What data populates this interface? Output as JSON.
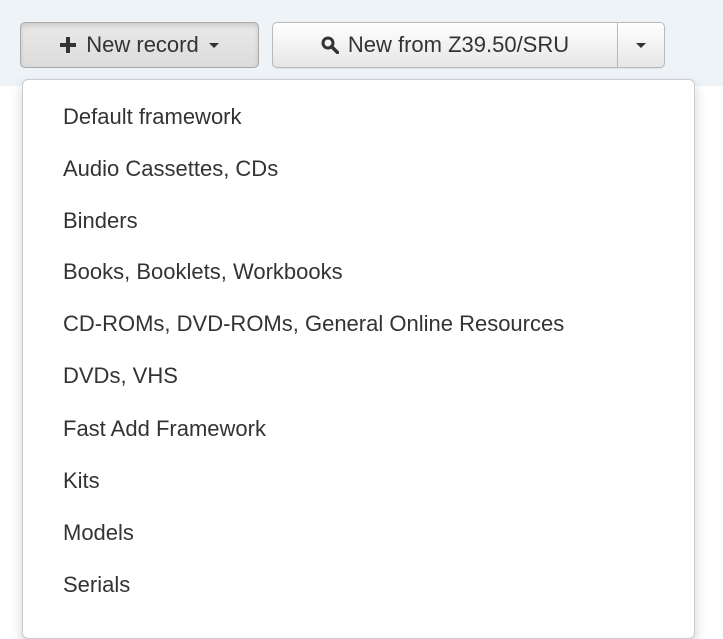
{
  "toolbar": {
    "new_record_label": "New record",
    "new_from_label": "New from Z39.50/SRU",
    "icons": {
      "new_record": "plus-icon",
      "new_from": "search-icon",
      "dropdown": "caret-down-icon"
    }
  },
  "framework_menu": {
    "items": [
      {
        "label": "Default framework"
      },
      {
        "label": "Audio Cassettes, CDs"
      },
      {
        "label": "Binders"
      },
      {
        "label": "Books, Booklets, Workbooks"
      },
      {
        "label": "CD-ROMs, DVD-ROMs, General Online Resources"
      },
      {
        "label": "DVDs, VHS"
      },
      {
        "label": "Fast Add Framework"
      },
      {
        "label": "Kits"
      },
      {
        "label": "Models"
      },
      {
        "label": "Serials"
      }
    ]
  },
  "colors": {
    "toolbar_background": "#eef3f7",
    "text": "#333333",
    "menu_border": "#cccccc"
  }
}
